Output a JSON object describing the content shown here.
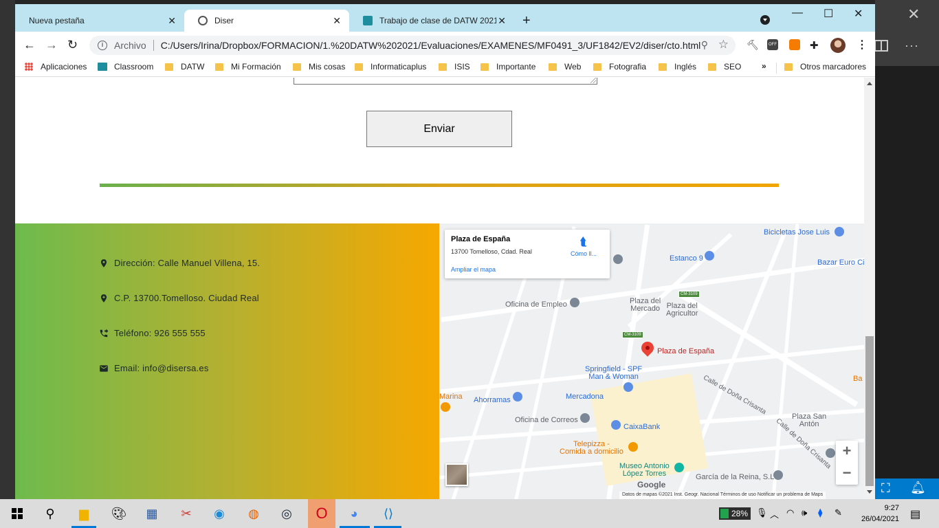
{
  "browser": {
    "tabs": [
      {
        "title": "Nueva pestaña",
        "active": false
      },
      {
        "title": "Diser",
        "active": true
      },
      {
        "title": "Trabajo de clase de DATW 2021",
        "active": false
      }
    ],
    "address": {
      "scheme_label": "Archivo",
      "url": "C:/Users/Irina/Dropbox/FORMACION/1.%20DATW%202021/Evaluaciones/EXAMENES/MF0491_3/UF1842/EV2/diser/cto.html"
    },
    "extensions": {
      "off_badge": "OFF"
    },
    "bookmarks": [
      {
        "label": "Aplicaciones",
        "icon": "apps-icon"
      },
      {
        "label": "Classroom",
        "icon": "classroom-icon"
      },
      {
        "label": "DATW",
        "icon": "folder-icon"
      },
      {
        "label": "Mi Formación",
        "icon": "folder-icon"
      },
      {
        "label": "Mis cosas",
        "icon": "folder-icon"
      },
      {
        "label": "Informaticaplus",
        "icon": "folder-icon"
      },
      {
        "label": "ISIS",
        "icon": "folder-icon"
      },
      {
        "label": "Importante",
        "icon": "folder-icon"
      },
      {
        "label": "Web",
        "icon": "folder-icon"
      },
      {
        "label": "Fotografia",
        "icon": "folder-icon"
      },
      {
        "label": "Inglés",
        "icon": "folder-icon"
      },
      {
        "label": "SEO",
        "icon": "folder-icon"
      }
    ],
    "bookmarks_more": "»",
    "other_bookmarks": "Otros marcadores"
  },
  "page": {
    "submit_label": "Enviar",
    "contact": {
      "address": "Dirección: Calle Manuel Villena, 15.",
      "postal": "C.P. 13700.Tomelloso. Ciudad Real",
      "phone": "Teléfono: 926 555 555",
      "email": "Email: info@disersa.es"
    },
    "map": {
      "card_title": "Plaza de España",
      "card_address": "13700 Tomelloso, Cdad. Real",
      "card_link": "Ampliar el mapa",
      "directions": "Cómo ll...",
      "marker_label": "Plaza de España",
      "places": {
        "bicicletas": "Bicicletas Jose Luis",
        "estanco": "Estanco 9",
        "bazar": "Bazar Euro Ci",
        "oficina_empleo": "Oficina de Empleo",
        "plaza_mercado": "Plaza del\nMercado",
        "plaza_agricultor": "Plaza del\nAgricultor",
        "springfield": "Springfield - SPF\nMan & Woman",
        "mercadona": "Mercadona",
        "ahorramas": "Ahorramas",
        "marina": "Marina",
        "correos": "Oficina de Correos",
        "caixabank": "CaixaBank",
        "telepizza": "Telepizza -\nComida a domicilio",
        "museo": "Museo Antonio\nLópez Torres",
        "garcia": "García de la Reina, S.L",
        "plaza_anton": "Plaza San\nAntón",
        "ba": "Ba",
        "calle_dona": "Calle de Doña Crisanta",
        "calle_dona2": "Calle de Doña Crisanta"
      },
      "road_badges": [
        "CM-3109",
        "CM-3109"
      ],
      "google": "Google",
      "attribution": "Datos de mapas ©2021 Inst. Geogr. Nacional   Términos de uso   Notificar un problema de Maps",
      "zoom_in": "+",
      "zoom_out": "−"
    }
  },
  "taskbar": {
    "battery": "28%",
    "time": "9:27",
    "date": "26/04/2021"
  }
}
